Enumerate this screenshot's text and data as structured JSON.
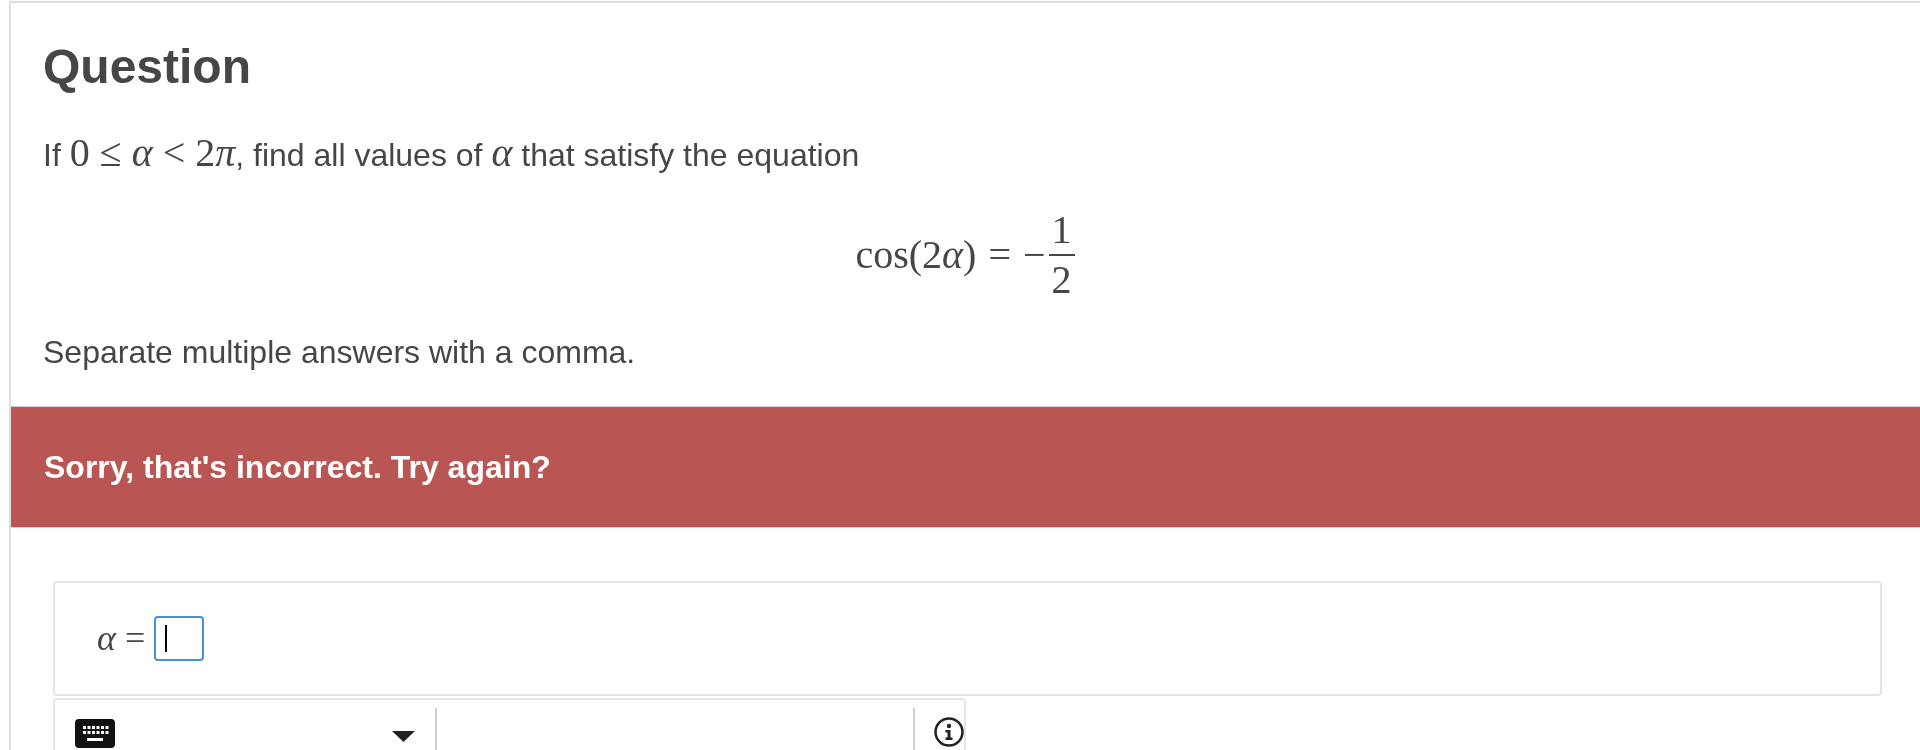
{
  "question": {
    "heading": "Question",
    "prompt": [
      {
        "kind": "text",
        "text": "If "
      },
      {
        "kind": "math",
        "text": "0 ≤ "
      },
      {
        "kind": "variable",
        "text": "α"
      },
      {
        "kind": "math",
        "text": " < 2"
      },
      {
        "kind": "variable",
        "text": "π"
      },
      {
        "kind": "text",
        "text": ", find all values of "
      },
      {
        "kind": "variable",
        "text": "α"
      },
      {
        "kind": "text",
        "text": " that satisfy the equation"
      }
    ],
    "equation": {
      "lhs": [
        {
          "kind": "math",
          "text": "cos(2"
        },
        {
          "kind": "variable",
          "text": "α"
        },
        {
          "kind": "math",
          "text": ")"
        }
      ],
      "relation": "=",
      "sign": "−",
      "numerator": "1",
      "denominator": "2"
    },
    "instruction": "Separate multiple answers with a comma."
  },
  "feedback": {
    "kind": "incorrect",
    "message": "Sorry, that's incorrect. Try again?"
  },
  "answer": {
    "variable": "α",
    "relation": "=",
    "focused": true
  }
}
